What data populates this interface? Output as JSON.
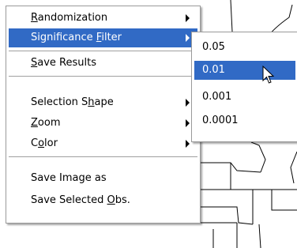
{
  "context_menu": {
    "items": [
      {
        "prefix": "",
        "mnemonic": "R",
        "suffix": "andomization",
        "submenu": true
      },
      {
        "prefix": "Significance ",
        "mnemonic": "F",
        "suffix": "ilter",
        "submenu": true,
        "highlighted": true
      },
      {
        "prefix": "",
        "mnemonic": "S",
        "suffix": "ave Results",
        "submenu": false
      },
      {
        "prefix": "Selection S",
        "mnemonic": "h",
        "suffix": "ape",
        "submenu": true
      },
      {
        "prefix": "",
        "mnemonic": "Z",
        "suffix": "oom",
        "submenu": true
      },
      {
        "prefix": "C",
        "mnemonic": "o",
        "suffix": "lor",
        "submenu": true
      },
      {
        "prefix": "Save Image as",
        "mnemonic": "",
        "suffix": "",
        "submenu": false
      },
      {
        "prefix": "Save Selected ",
        "mnemonic": "O",
        "suffix": "bs.",
        "submenu": false
      }
    ]
  },
  "significance_submenu": {
    "items": [
      "0.05",
      "0.01",
      "0.001",
      "0.0001"
    ],
    "selected": "0.01"
  },
  "colors": {
    "highlight": "#316ac5",
    "map_lines": "#000000"
  },
  "icons": {
    "submenu_arrow": "triangle-right-icon",
    "cursor": "arrow-pointer-icon"
  }
}
